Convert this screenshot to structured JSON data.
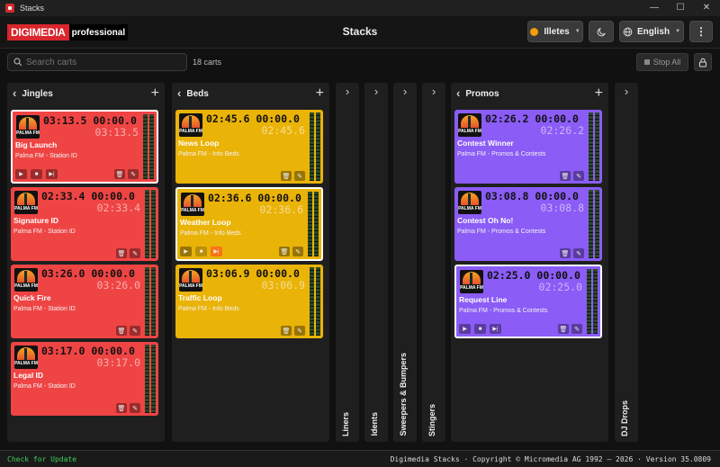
{
  "window": {
    "title": "Stacks",
    "minimize": "—",
    "maximize": "☐",
    "close": "✕"
  },
  "header": {
    "logo_brand": "DIGIMEDIA",
    "logo_sub": "professional",
    "title": "Stacks",
    "station_label": "Illetes",
    "language_label": "English"
  },
  "toolbar": {
    "search_placeholder": "Search carts",
    "cart_count": "18 carts",
    "stop_all_label": "Stop All"
  },
  "colors": {
    "red": "#ef4444",
    "yellow": "#eab308",
    "purple": "#8b5cf6",
    "green": "#3ecf5a"
  },
  "columns": [
    {
      "title": "Jingles",
      "color": "#ef4444",
      "carts": [
        {
          "remaining": "03:13.5",
          "elapsed": "00:00.0",
          "duration": "03:13.5",
          "name": "Big Launch",
          "sub": "Palma FM - Station ID",
          "logo": "PALMA FM",
          "selected": true,
          "controls": true
        },
        {
          "remaining": "02:33.4",
          "elapsed": "00:00.0",
          "duration": "02:33.4",
          "name": "Signature ID",
          "sub": "Palma FM - Station ID",
          "logo": "PALMA FM"
        },
        {
          "remaining": "03:26.0",
          "elapsed": "00:00.0",
          "duration": "03:26.0",
          "name": "Quick Fire",
          "sub": "Palma FM - Station ID",
          "logo": "PALMA FM"
        },
        {
          "remaining": "03:17.0",
          "elapsed": "00:00.0",
          "duration": "03:17.0",
          "name": "Legal ID",
          "sub": "Palma FM - Station ID",
          "logo": "PALMA FM"
        }
      ]
    },
    {
      "title": "Beds",
      "color": "#eab308",
      "carts": [
        {
          "remaining": "02:45.6",
          "elapsed": "00:00.0",
          "duration": "02:45.6",
          "name": "News Loop",
          "sub": "Palma FM - Info Beds",
          "logo": "PALMA FM"
        },
        {
          "remaining": "02:36.6",
          "elapsed": "00:00.0",
          "duration": "02:36.6",
          "name": "Weather Loop",
          "sub": "Palma FM - Info Beds",
          "logo": "PALMA FM",
          "selected": true,
          "controls": true
        },
        {
          "remaining": "03:06.9",
          "elapsed": "00:00.0",
          "duration": "03:06.9",
          "name": "Traffic Loop",
          "sub": "Palma FM - Info Beds",
          "logo": "PALMA FM"
        }
      ]
    },
    {
      "title": "Promos",
      "color": "#8b5cf6",
      "carts": [
        {
          "remaining": "02:26.2",
          "elapsed": "00:00.0",
          "duration": "02:26.2",
          "name": "Contest Winner",
          "sub": "Palma FM - Promos & Contests",
          "logo": "PALMA FM"
        },
        {
          "remaining": "03:08.8",
          "elapsed": "00:00.0",
          "duration": "03:08.8",
          "name": "Contest Oh No!",
          "sub": "Palma FM - Promos & Contests",
          "logo": "PALMA FM"
        },
        {
          "remaining": "02:25.0",
          "elapsed": "00:00.0",
          "duration": "02:25.0",
          "name": "Request Line",
          "sub": "Palma FM - Promos & Contests",
          "logo": "PALMA FM",
          "selected": true,
          "controls": true
        }
      ]
    }
  ],
  "collapsed": [
    "Liners",
    "Idents",
    "Sweepers & Bumpers",
    "Stingers",
    "DJ Drops"
  ],
  "footer": {
    "update_label": "Check for Update",
    "info": "Digimedia Stacks · Copyright © Micromedia AG 1992 – 2026 · Version 35.0809"
  }
}
